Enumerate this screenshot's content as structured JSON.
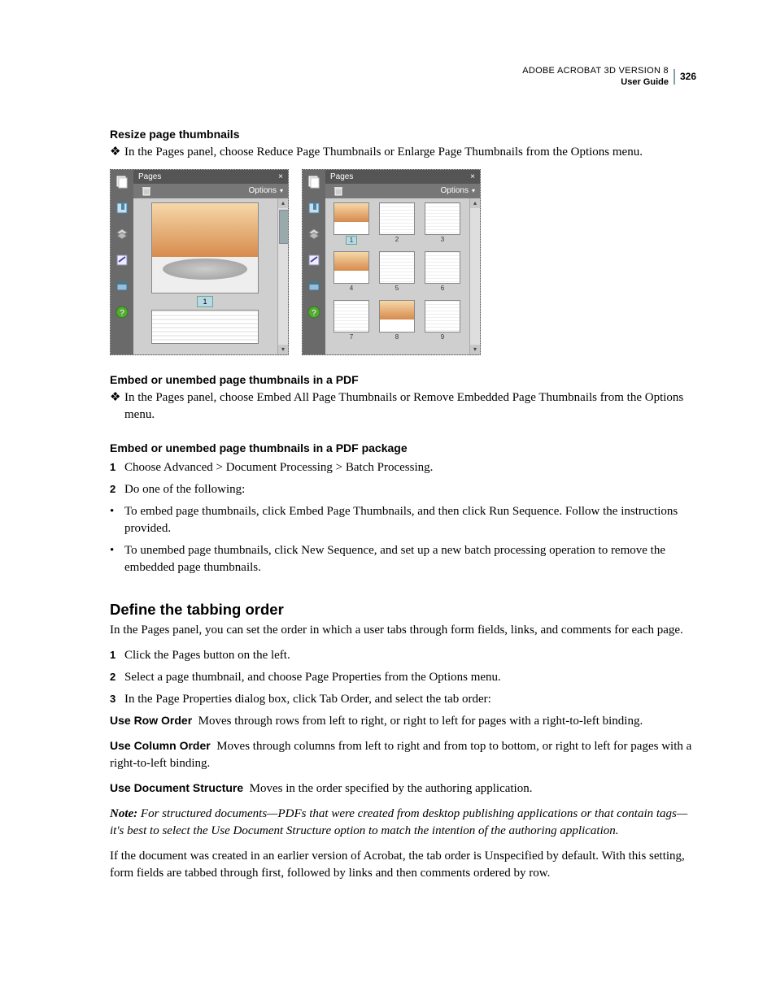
{
  "header": {
    "title": "ADOBE ACROBAT 3D VERSION 8",
    "subtitle": "User Guide",
    "page_number": "326"
  },
  "sections": {
    "resize": {
      "heading": "Resize page thumbnails",
      "diamond_text": "In the Pages panel, choose Reduce Page Thumbnails or Enlarge Page Thumbnails from the Options menu."
    },
    "embed_pdf": {
      "heading": "Embed or unembed page thumbnails in a PDF",
      "diamond_text": "In the Pages panel, choose Embed All Page Thumbnails or Remove Embedded Page Thumbnails from the Options menu."
    },
    "embed_pkg": {
      "heading": "Embed or unembed page thumbnails in a PDF package",
      "step1": "Choose Advanced > Document Processing > Batch Processing.",
      "step2": "Do one of the following:",
      "bullet1": "To embed page thumbnails, click Embed Page Thumbnails, and then click Run Sequence. Follow the instructions provided.",
      "bullet2": "To unembed page thumbnails, click New Sequence, and set up a new batch processing operation to remove the embedded page thumbnails."
    },
    "tabbing": {
      "heading": "Define the tabbing order",
      "intro": "In the Pages panel, you can set the order in which a user tabs through form fields, links, and comments for each page.",
      "step1": "Click the Pages button on the left.",
      "step2": "Select a page thumbnail, and choose Page Properties from the Options menu.",
      "step3": "In the Page Properties dialog box, click Tab Order, and select the tab order:",
      "row_label": "Use Row Order",
      "row_text": "Moves through rows from left to right, or right to left for pages with a right-to-left binding.",
      "col_label": "Use Column Order",
      "col_text": "Moves through columns from left to right and from top to bottom, or right to left for pages with a right-to-left binding.",
      "doc_label": "Use Document Structure",
      "doc_text": "Moves in the order specified by the authoring application.",
      "note_label": "Note:",
      "note_text": "For structured documents—PDFs that were created from desktop publishing applications or that contain tags—it's best to select the Use Document Structure option to match the intention of the authoring application.",
      "final": "If the document was created in an earlier version of Acrobat, the tab order is Unspecified by default. With this setting, form fields are tabbed through first, followed by links and then comments ordered by row."
    }
  },
  "panel": {
    "title": "Pages",
    "close": "×",
    "options": "Options",
    "page1": "1",
    "labels": [
      "1",
      "2",
      "3",
      "4",
      "5",
      "6",
      "7",
      "8",
      "9"
    ]
  },
  "nums": {
    "n1": "1",
    "n2": "2",
    "n3": "3"
  },
  "glyphs": {
    "diamond": "❖",
    "bullet": "•",
    "tri": "▾"
  }
}
